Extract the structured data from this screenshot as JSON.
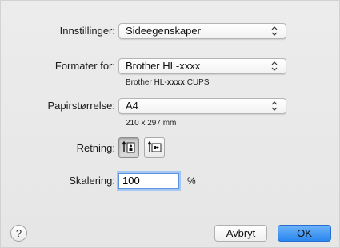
{
  "settings": {
    "label": "Innstillinger:",
    "value": "Sideegenskaper"
  },
  "format_for": {
    "label": "Formater for:",
    "value": "Brother HL-xxxx",
    "printer_prefix": "Brother HL-",
    "printer_model": "xxxx",
    "printer_suffix": "CUPS"
  },
  "paper_size": {
    "label": "Papirstørrelse:",
    "value": "A4",
    "dimensions": "210 x 297 mm"
  },
  "orientation": {
    "label": "Retning:",
    "selected": "portrait",
    "options": [
      "portrait-icon",
      "landscape-icon"
    ]
  },
  "scale": {
    "label": "Skalering:",
    "value": "100",
    "unit": "%"
  },
  "buttons": {
    "help": "?",
    "cancel": "Avbryt",
    "ok": "OK"
  },
  "colors": {
    "accent": "#2a86ee",
    "focus_ring": "#a4c7f4"
  }
}
